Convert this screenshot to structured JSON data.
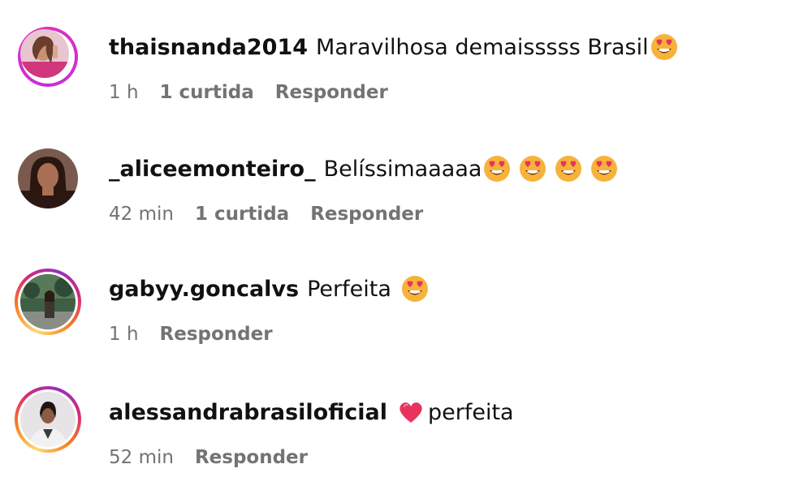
{
  "comments": [
    {
      "username": "thaisnanda2014",
      "text": "Maravilhosa demaisssss Brasil",
      "emojis": [
        "heart-eyes-icon"
      ],
      "time": "1 h",
      "likes": "1 curtida",
      "reply": "Responder"
    },
    {
      "username": "_aliceemonteiro_",
      "text": "Belíssimaaaaa",
      "emojis": [
        "heart-eyes-icon",
        "heart-eyes-icon",
        "heart-eyes-icon",
        "heart-eyes-icon"
      ],
      "time": "42 min",
      "likes": "1 curtida",
      "reply": "Responder"
    },
    {
      "username": "gabyy.goncalvs",
      "text": "Perfeita",
      "emojis": [
        "heart-eyes-icon"
      ],
      "time": "1 h",
      "reply": "Responder"
    },
    {
      "username": "alessandrabrasiloficial",
      "text": "perfeita",
      "emojis_before": [
        "red-heart-icon"
      ],
      "time": "52 min",
      "reply": "Responder"
    }
  ],
  "colors": {
    "text": "#111111",
    "meta": "#737373",
    "story_ring": "#d62976",
    "heart": "#e8335e",
    "emoji_face": "#f7b23b"
  }
}
